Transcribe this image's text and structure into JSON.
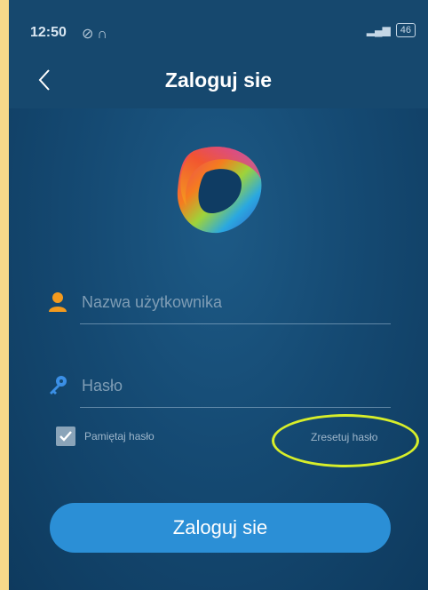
{
  "status_bar": {
    "time": "12:50",
    "icons": [
      "alarm-off-icon",
      "headphones-icon"
    ],
    "signal": "signal-icon",
    "battery": "46"
  },
  "header": {
    "title": "Zaloguj sie",
    "back_icon": "chevron-left-icon"
  },
  "logo": {
    "icon": "app-logo"
  },
  "form": {
    "username_placeholder": "Nazwa użytkownika",
    "password_placeholder": "Hasło",
    "remember_label": "Pamiętaj hasło",
    "remember_checked": true,
    "reset_label": "Zresetuj hasło",
    "submit_label": "Zaloguj sie"
  },
  "colors": {
    "background": "#154a73",
    "header": "#16486e",
    "accent_button": "#2b8fd6",
    "icon_orange": "#f39a1e",
    "icon_blue": "#3b8fe6",
    "highlight": "#d7ee2a"
  }
}
